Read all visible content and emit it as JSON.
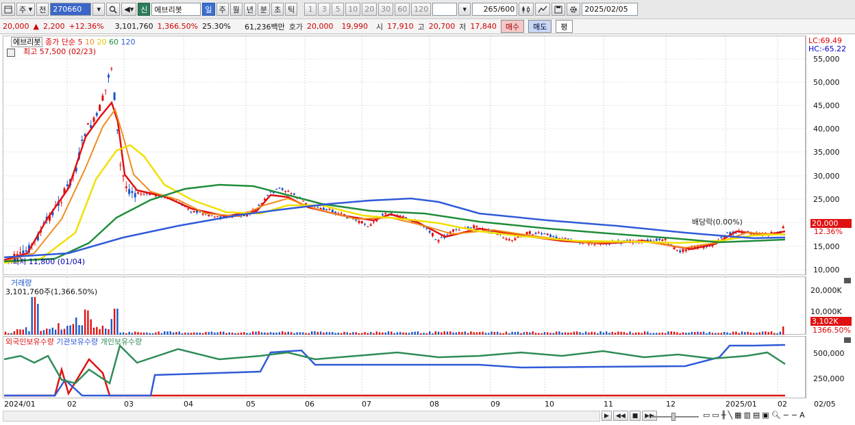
{
  "toolbar": {
    "market_type": "주",
    "prev_label": "전",
    "stock_code": "270660",
    "stock_badge": "신",
    "stock_name": "에브리봇",
    "periods": [
      "일",
      "주",
      "월",
      "년",
      "분",
      "초",
      "틱"
    ],
    "active_period": "일",
    "intervals": [
      "1",
      "3",
      "5",
      "10",
      "20",
      "30",
      "60",
      "120"
    ],
    "count": "265",
    "count_max": "/600",
    "date": "2025/02/05"
  },
  "quote": {
    "price": "20,000",
    "change": "2,200",
    "change_pct": "+12.36%",
    "volume": "3,101,760",
    "volume_ratio": "1,366.50%",
    "turnover": "25.30%",
    "amount": "61,236백만",
    "bid_label": "호가",
    "ask": "20,000",
    "bid": "19,990",
    "open_label": "시",
    "open": "17,910",
    "high_label": "고",
    "high": "20,700",
    "low_label": "저",
    "low": "17,840",
    "buy_label": "매수",
    "sell_label": "매도",
    "avg_label": "평"
  },
  "price_panel": {
    "stock_label": "에브리봇",
    "ma_label": "종가 단순",
    "ma_periods": [
      "5",
      "10",
      "20",
      "60",
      "120"
    ],
    "ma_colors": [
      "#e01010",
      "#f08c1e",
      "#f0e000",
      "#1f8c3a",
      "#2f5ad8"
    ],
    "max_annotation": "최고 57,500 (02/23)",
    "min_annotation": "최저 11,800 (01/04)",
    "dividend_annotation": "배당락(0.00%)",
    "lc": "LC:69.49",
    "hc": "HC:-65.22",
    "y_ticks": [
      "55,000",
      "50,000",
      "45,000",
      "40,000",
      "35,000",
      "30,000",
      "25,000",
      "20,000",
      "15,000",
      "10,000"
    ],
    "last_price_tag": "20,000",
    "last_change_tag": "12.36%"
  },
  "volume_panel": {
    "title": "거래량",
    "value_text": "3,101,760주(1,366.50%)",
    "y_ticks": [
      "20,000K",
      "10,000K"
    ],
    "last_tag": "3,102K",
    "last_ratio_tag": "1366.50%"
  },
  "holding_panel": {
    "series": [
      "외국인보유수량",
      "기관보유수량",
      "개인보유수량"
    ],
    "colors": [
      "#e01010",
      "#2f5ad8",
      "#2e8b57"
    ],
    "y_ticks": [
      "500,000",
      "250,000"
    ]
  },
  "x_axis": {
    "labels": [
      "2024/01",
      "02",
      "03",
      "04",
      "05",
      "06",
      "07",
      "08",
      "09",
      "10",
      "11",
      "12",
      "2025/01",
      "02"
    ],
    "right_label": "02/05"
  }
}
